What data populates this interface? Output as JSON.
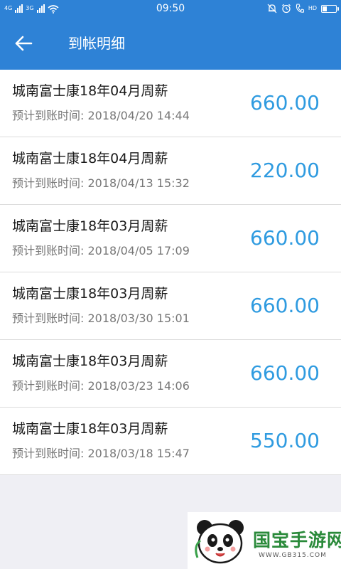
{
  "status_bar": {
    "network_label": "4G",
    "network_label_2": "3G",
    "time": "09:50",
    "hd_label": "HD",
    "battery_level": 0.35
  },
  "header": {
    "title": "到帐明细"
  },
  "records": [
    {
      "title": "城南富士康18年04月周薪",
      "expected_label": "预计到账时间: 2018/04/20 14:44",
      "amount": "660.00"
    },
    {
      "title": "城南富士康18年04月周薪",
      "expected_label": "预计到账时间: 2018/04/13 15:32",
      "amount": "220.00"
    },
    {
      "title": "城南富士康18年03月周薪",
      "expected_label": "预计到账时间: 2018/04/05 17:09",
      "amount": "660.00"
    },
    {
      "title": "城南富士康18年03月周薪",
      "expected_label": "预计到账时间: 2018/03/30 15:01",
      "amount": "660.00"
    },
    {
      "title": "城南富士康18年03月周薪",
      "expected_label": "预计到账时间: 2018/03/23 14:06",
      "amount": "660.00"
    },
    {
      "title": "城南富士康18年03月周薪",
      "expected_label": "预计到账时间: 2018/03/18 15:47",
      "amount": "550.00"
    }
  ],
  "watermark": {
    "brand": "国宝手游网",
    "url": "WWW.GB315.COM"
  },
  "colors": {
    "primary": "#2e82d6",
    "amount": "#2f9be0",
    "background": "#efeff4"
  }
}
